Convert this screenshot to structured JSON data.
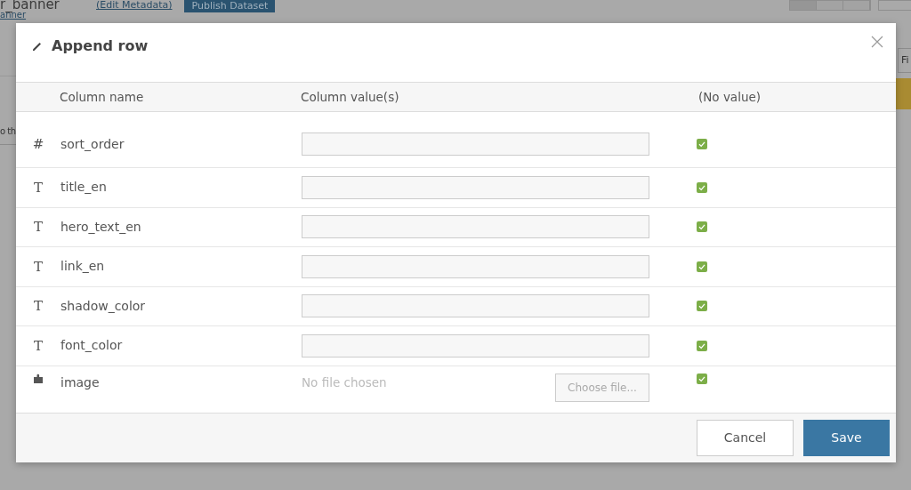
{
  "page": {
    "title": "r_banner",
    "edit_link": "(Edit Metadata)",
    "publish_button": "Publish Dataset",
    "breadcrumb_link": "anner",
    "side_text": "o th",
    "column_fragment": "Fi"
  },
  "modal": {
    "title": "Append row",
    "columns": [
      "Column name",
      "Column value(s)",
      "(No value)"
    ],
    "rows": [
      {
        "kind": "text",
        "type_icon": "#",
        "name": "sort_order",
        "no_value": true
      },
      {
        "kind": "text",
        "type_icon": "T",
        "name": "title_en",
        "no_value": true
      },
      {
        "kind": "text",
        "type_icon": "T",
        "name": "hero_text_en",
        "no_value": true
      },
      {
        "kind": "text",
        "type_icon": "T",
        "name": "link_en",
        "no_value": true
      },
      {
        "kind": "text",
        "type_icon": "T",
        "name": "shadow_color",
        "no_value": true
      },
      {
        "kind": "text",
        "type_icon": "T",
        "name": "font_color",
        "no_value": true
      },
      {
        "kind": "file",
        "name": "image",
        "file_status": "No file chosen",
        "file_button": "Choose file...",
        "no_value": true
      }
    ],
    "buttons": [
      {
        "label": "Cancel",
        "kind": "secondary"
      },
      {
        "label": "Save",
        "kind": "primary"
      }
    ]
  }
}
